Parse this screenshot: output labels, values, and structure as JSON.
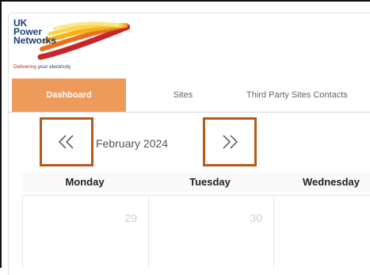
{
  "logo": {
    "line1": "UK",
    "line2": "Power",
    "line3": "Networks",
    "tagline_main": "Delivering",
    "tagline_rest": " your electricity"
  },
  "tabs": [
    {
      "label": "Dashboard",
      "active": true
    },
    {
      "label": "Sites",
      "active": false
    },
    {
      "label": "Third Party Sites Contacts",
      "active": false
    }
  ],
  "calendar": {
    "month_label": "February 2024",
    "prev_icon": "double-chevron-left-icon",
    "next_icon": "double-chevron-right-icon",
    "weekdays": [
      "Monday",
      "Tuesday",
      "Wednesday"
    ],
    "dates": [
      "29",
      "30",
      ""
    ]
  },
  "colors": {
    "active_tab": "#ee9a5b",
    "highlight_border": "#b5591b",
    "brand_blue": "#1f3c78",
    "brand_red": "#c8242b"
  }
}
